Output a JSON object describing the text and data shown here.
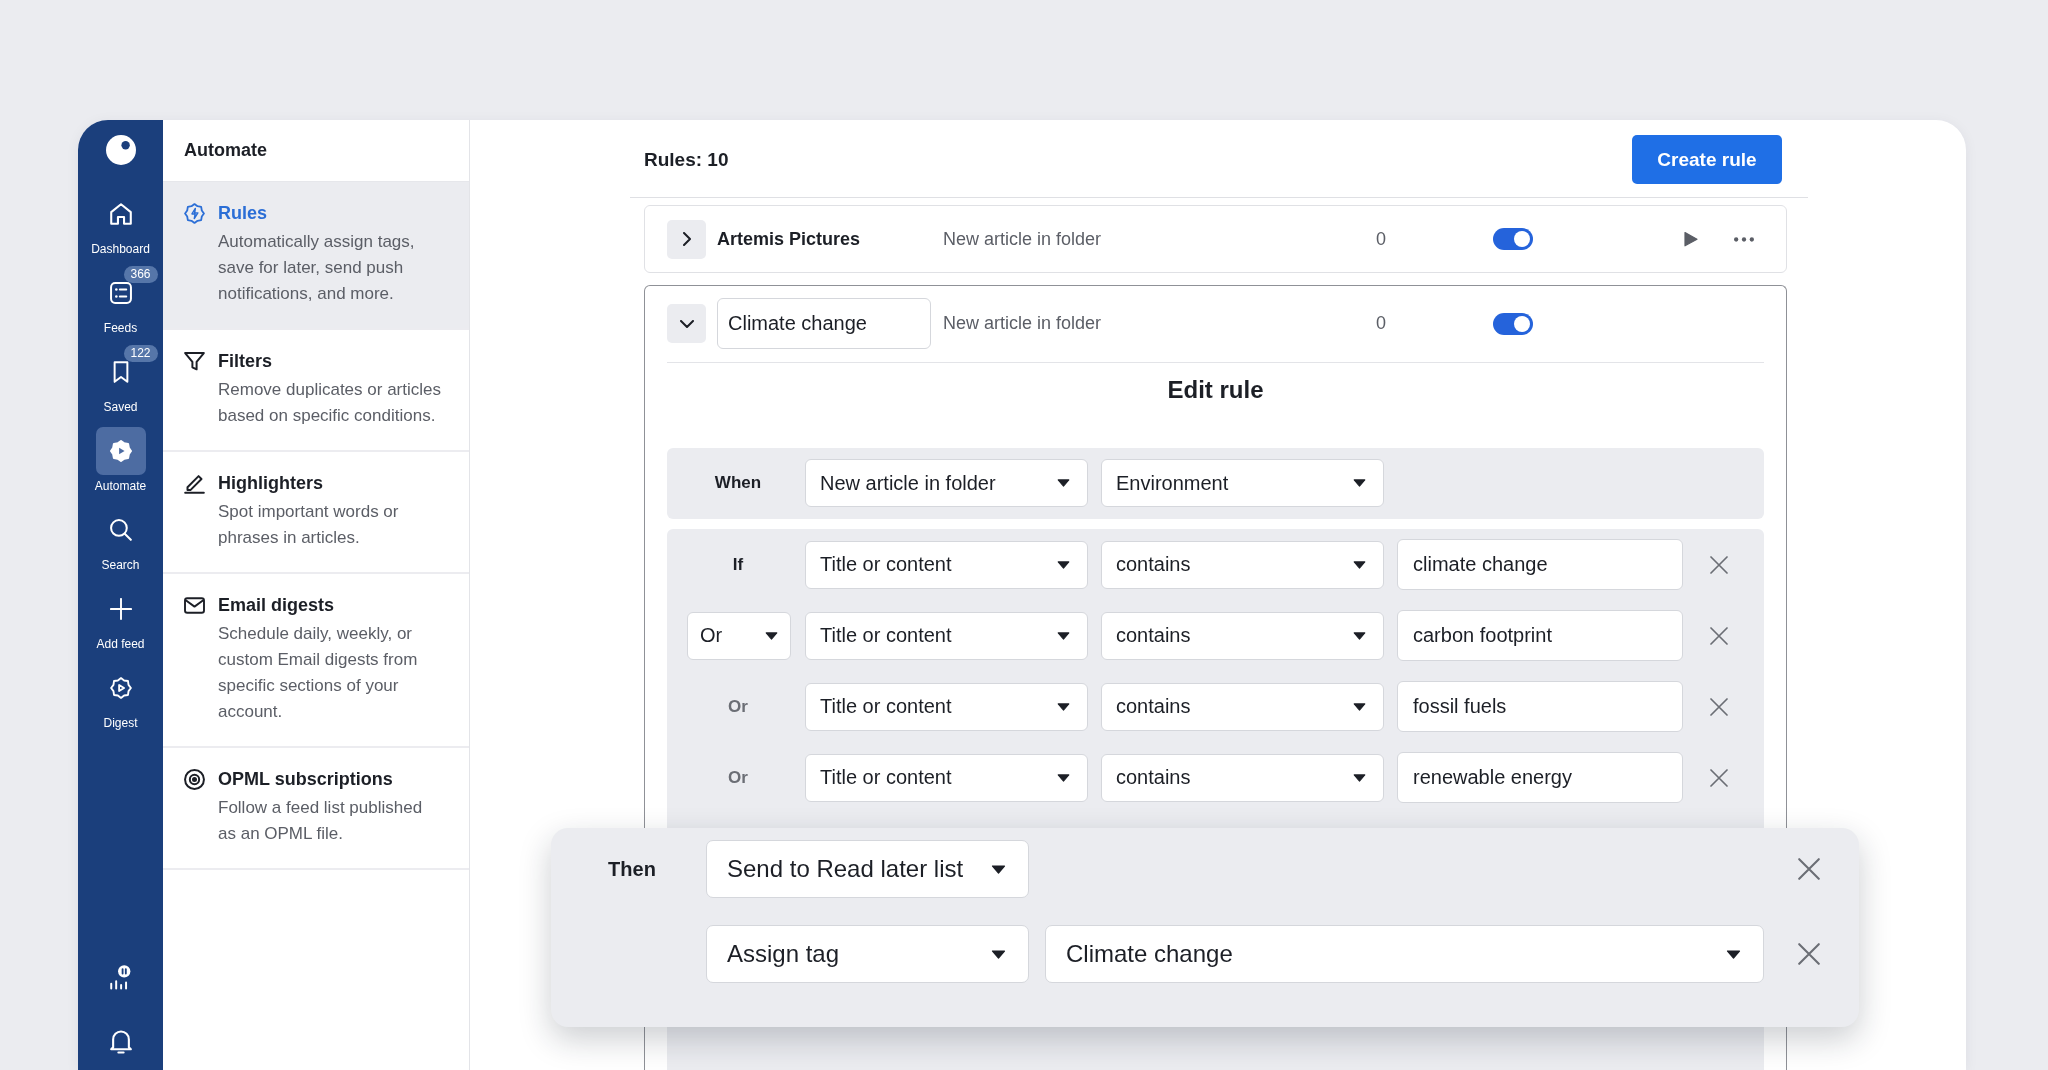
{
  "sidebar": {
    "items": [
      {
        "label": "Dashboard",
        "selected": false
      },
      {
        "label": "Feeds",
        "badge": "366",
        "selected": false
      },
      {
        "label": "Saved",
        "badge": "122",
        "selected": false
      },
      {
        "label": "Automate",
        "selected": true
      },
      {
        "label": "Search",
        "selected": false
      },
      {
        "label": "Add feed",
        "selected": false
      },
      {
        "label": "Digest",
        "selected": false
      }
    ]
  },
  "menu": {
    "title": "Automate",
    "items": [
      {
        "title": "Rules",
        "description": "Automatically assign tags, save for later, send push notifications, and more.",
        "selected": true
      },
      {
        "title": "Filters",
        "description": "Remove duplicates or articles based on specific conditions.",
        "selected": false
      },
      {
        "title": "Highlighters",
        "description": "Spot important words or phrases in articles.",
        "selected": false
      },
      {
        "title": "Email digests",
        "description": "Schedule daily, weekly, or custom Email digests from specific sections of your account.",
        "selected": false
      },
      {
        "title": "OPML subscriptions",
        "description": "Follow a feed list published as an OPML file.",
        "selected": false
      }
    ]
  },
  "header": {
    "count": "Rules: 10",
    "create_button": "Create rule"
  },
  "rules": [
    {
      "name": "Artemis Pictures",
      "trigger": "New article in folder",
      "count": "0",
      "enabled": true,
      "expanded": false
    },
    {
      "name": "Climate change",
      "trigger": "New article in folder",
      "count": "0",
      "enabled": true,
      "expanded": true
    }
  ],
  "editor": {
    "title": "Edit rule",
    "when": {
      "label": "When",
      "trigger": "New article in folder",
      "folder": "Environment"
    },
    "conditions": [
      {
        "kind": "label",
        "connector": "If",
        "field": "Title or content",
        "operator": "contains",
        "value": "climate change"
      },
      {
        "kind": "select",
        "connector": "Or",
        "field": "Title or content",
        "operator": "contains",
        "value": "carbon footprint"
      },
      {
        "kind": "inherited",
        "connector": "Or",
        "field": "Title or content",
        "operator": "contains",
        "value": "fossil fuels"
      },
      {
        "kind": "inherited",
        "connector": "Or",
        "field": "Title or content",
        "operator": "contains",
        "value": "renewable energy"
      }
    ],
    "then": {
      "label": "Then",
      "actions": [
        {
          "action": "Send to Read later list"
        },
        {
          "action": "Assign tag",
          "target": "Climate change"
        }
      ]
    }
  }
}
